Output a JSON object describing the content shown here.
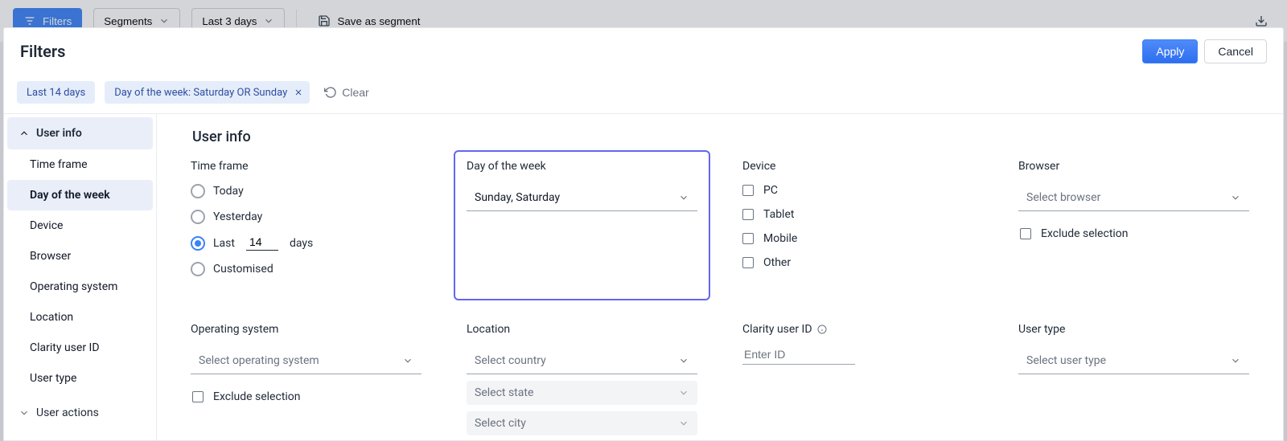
{
  "toolbar": {
    "filters": "Filters",
    "segments": "Segments",
    "date_range": "Last 3 days",
    "save_segment": "Save as segment"
  },
  "modal": {
    "title": "Filters",
    "apply": "Apply",
    "cancel": "Cancel",
    "clear": "Clear"
  },
  "chips": {
    "date": "Last 14 days",
    "dow": "Day of the week: Saturday OR Sunday"
  },
  "sidebar": {
    "group_user_info": "User info",
    "items": [
      {
        "label": "Time frame"
      },
      {
        "label": "Day of the week"
      },
      {
        "label": "Device"
      },
      {
        "label": "Browser"
      },
      {
        "label": "Operating system"
      },
      {
        "label": "Location"
      },
      {
        "label": "Clarity user ID"
      },
      {
        "label": "User type"
      }
    ],
    "group_user_actions": "User actions"
  },
  "panel": {
    "heading": "User info",
    "time_frame": {
      "title": "Time frame",
      "today": "Today",
      "yesterday": "Yesterday",
      "last_prefix": "Last",
      "last_value": "14",
      "last_suffix": "days",
      "customised": "Customised"
    },
    "dow": {
      "title": "Day of the week",
      "value": "Sunday, Saturday"
    },
    "device": {
      "title": "Device",
      "options": [
        "PC",
        "Tablet",
        "Mobile",
        "Other"
      ]
    },
    "browser": {
      "title": "Browser",
      "placeholder": "Select browser",
      "exclude": "Exclude selection"
    },
    "os": {
      "title": "Operating system",
      "placeholder": "Select operating system",
      "exclude": "Exclude selection"
    },
    "location": {
      "title": "Location",
      "country": "Select country",
      "state": "Select state",
      "city": "Select city"
    },
    "clarity": {
      "title": "Clarity user ID",
      "placeholder": "Enter ID"
    },
    "user_type": {
      "title": "User type",
      "placeholder": "Select user type"
    }
  }
}
